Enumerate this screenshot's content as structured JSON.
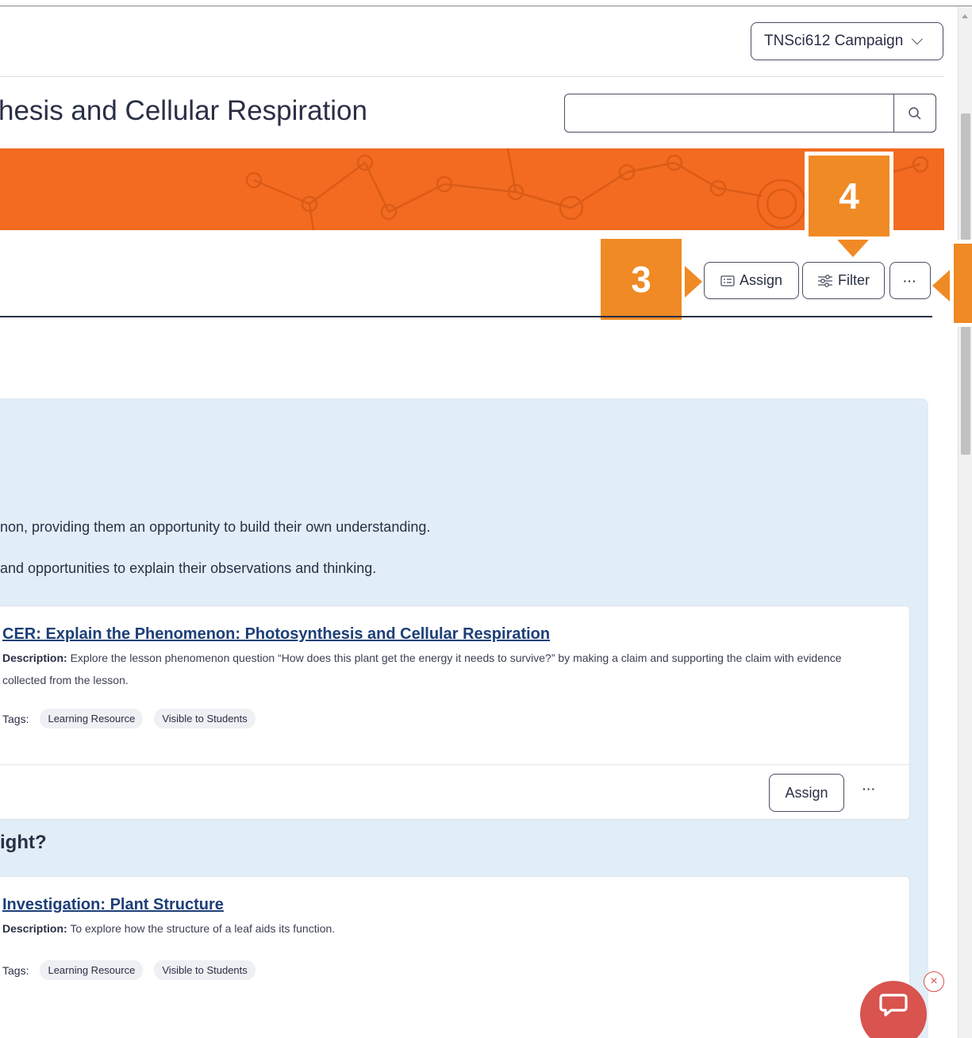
{
  "header": {
    "campaign_label": "TNSci612 Campaign",
    "page_title": "hesis and Cellular Respiration",
    "search_placeholder": ""
  },
  "callouts": {
    "three": "3",
    "four": "4",
    "five": ""
  },
  "toolbar": {
    "assign_label": "Assign",
    "filter_label": "Filter",
    "more_label": "···"
  },
  "intro": {
    "line1": "non, providing them an opportunity to build their own understanding.",
    "line2": "and opportunities to explain their observations and thinking."
  },
  "cards": [
    {
      "title": "CER: Explain the Phenomenon: Photosynthesis and Cellular Respiration",
      "desc_label": "Description:",
      "desc_text": " Explore the lesson phenomenon question “How does this plant get the energy it needs to survive?” by making a claim and supporting the claim with evidence collected from the lesson.",
      "tags_label": "Tags:",
      "tags": [
        "Learning Resource",
        "Visible to Students"
      ],
      "assign_label": "Assign",
      "more_label": "···"
    },
    {
      "title": "Investigation: Plant Structure",
      "desc_label": "Description:",
      "desc_text": " To explore how the structure of a leaf aids its function.",
      "tags_label": "Tags:",
      "tags": [
        "Learning Resource",
        "Visible to Students"
      ]
    }
  ],
  "section_heading": "ight?",
  "chat": {
    "close_symbol": "×"
  },
  "colors": {
    "banner": "#f26b21",
    "callout": "#f08a24",
    "panel": "#e1edf7",
    "link": "#1d3f78",
    "chat": "#d9534f"
  }
}
